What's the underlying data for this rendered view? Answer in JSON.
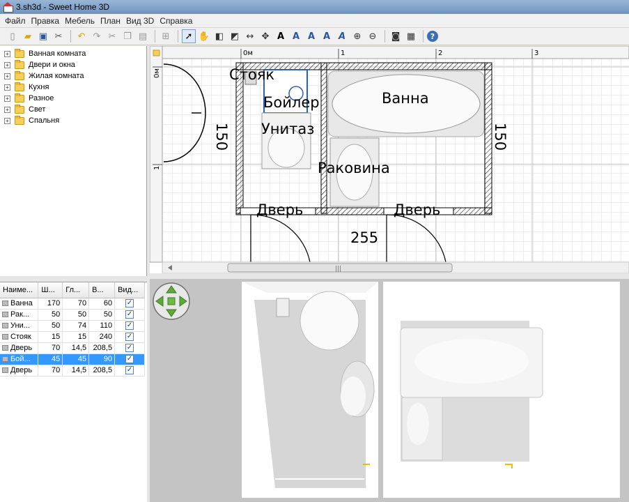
{
  "window": {
    "title": "3.sh3d - Sweet Home 3D"
  },
  "menu": [
    "Файл",
    "Правка",
    "Мебель",
    "План",
    "Вид 3D",
    "Справка"
  ],
  "toolbar": {
    "icons": [
      "new-icon",
      "open-icon",
      "save-icon",
      "preferences-icon",
      "undo-icon",
      "redo-icon",
      "cut-icon",
      "copy-icon",
      "paste-icon",
      "add-furniture-icon",
      "select-icon",
      "pan-icon",
      "create-walls-icon",
      "create-rooms-icon",
      "create-dimensions-icon",
      "create-labels-icon",
      "increase-text-icon",
      "decrease-text-icon",
      "bold-icon",
      "italic-icon",
      "zoom-in-icon",
      "zoom-out-icon",
      "photo-icon",
      "video-icon",
      "help-icon"
    ]
  },
  "catalog": {
    "items": [
      "Ванная комната",
      "Двери и окна",
      "Жилая комната",
      "Кухня",
      "Разное",
      "Свет",
      "Спальня"
    ]
  },
  "furniture_table": {
    "columns": [
      "Наиме...",
      "Ш...",
      "Гл...",
      "В...",
      "Вид..."
    ],
    "rows": [
      {
        "name": "Ванна",
        "w": "170",
        "d": "70",
        "h": "60",
        "visible": true,
        "selected": false
      },
      {
        "name": "Рак...",
        "w": "50",
        "d": "50",
        "h": "50",
        "visible": true,
        "selected": false
      },
      {
        "name": "Уни...",
        "w": "50",
        "d": "74",
        "h": "110",
        "visible": true,
        "selected": false
      },
      {
        "name": "Стояк",
        "w": "15",
        "d": "15",
        "h": "240",
        "visible": true,
        "selected": false
      },
      {
        "name": "Дверь",
        "w": "70",
        "d": "14,5",
        "h": "208,5",
        "visible": true,
        "selected": false
      },
      {
        "name": "Бой...",
        "w": "45",
        "d": "45",
        "h": "90",
        "visible": true,
        "selected": true
      },
      {
        "name": "Дверь",
        "w": "70",
        "d": "14,5",
        "h": "208,5",
        "visible": true,
        "selected": false
      }
    ]
  },
  "plan": {
    "ruler_top": [
      "0м",
      "1",
      "2",
      "3"
    ],
    "ruler_left": [
      "0м",
      "1"
    ],
    "labels": {
      "stoyak": "Стояк",
      "boiler": "Бойлер",
      "unitaz": "Унитаз",
      "vanna": "Ванна",
      "rakovina": "Раковина",
      "door1": "Дверь",
      "door2": "Дверь"
    },
    "dimensions": {
      "left_height": "150",
      "right_height": "150",
      "bottom_width": "255"
    },
    "scrollbar_grip": "|||"
  },
  "view3d": {
    "nav_control": "navigation-arrows-icon"
  },
  "colors": {
    "selection": "#3399ff",
    "grid": "#d9d9d9",
    "wall_hatch": "#000000"
  }
}
